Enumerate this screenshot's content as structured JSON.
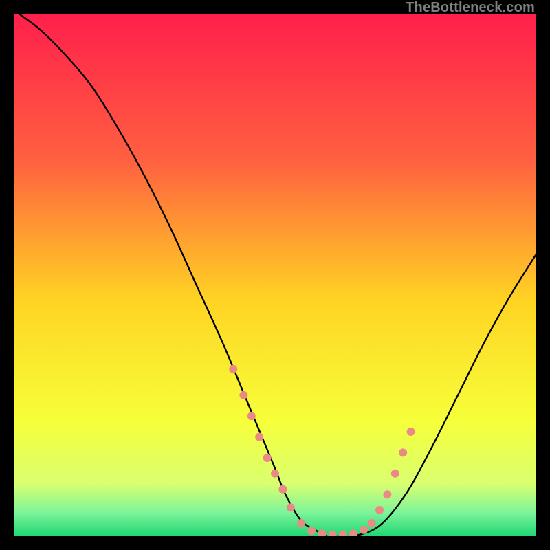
{
  "watermark": "TheBottleneck.com",
  "chart_data": {
    "type": "line",
    "title": "",
    "xlabel": "",
    "ylabel": "",
    "xlim": [
      0,
      100
    ],
    "ylim": [
      0,
      100
    ],
    "grid": false,
    "legend": false,
    "gradient_stops": [
      {
        "offset": 0.0,
        "color": "#ff1f4b"
      },
      {
        "offset": 0.28,
        "color": "#ff6040"
      },
      {
        "offset": 0.55,
        "color": "#ffd423"
      },
      {
        "offset": 0.78,
        "color": "#f6ff3a"
      },
      {
        "offset": 0.9,
        "color": "#d9ff70"
      },
      {
        "offset": 0.955,
        "color": "#7cf49a"
      },
      {
        "offset": 1.0,
        "color": "#1fd673"
      }
    ],
    "series": [
      {
        "name": "bottleneck-curve",
        "color": "#000000",
        "x": [
          1,
          5,
          10,
          15,
          20,
          25,
          30,
          35,
          40,
          45,
          50,
          52,
          55,
          58,
          60,
          62,
          65,
          70,
          75,
          80,
          85,
          90,
          95,
          100
        ],
        "y": [
          100,
          97,
          92,
          86,
          78,
          69,
          59,
          48,
          37,
          25,
          13,
          8,
          3,
          1,
          0,
          0,
          0,
          2,
          8,
          17,
          27,
          37,
          46,
          54
        ]
      }
    ],
    "markers": {
      "name": "highlight-dots",
      "color": "#e98a85",
      "radius_px": 6,
      "points": [
        {
          "x": 42,
          "y": 32
        },
        {
          "x": 44,
          "y": 27
        },
        {
          "x": 45.5,
          "y": 23
        },
        {
          "x": 47,
          "y": 19
        },
        {
          "x": 48.5,
          "y": 15
        },
        {
          "x": 50,
          "y": 12
        },
        {
          "x": 51.5,
          "y": 9
        },
        {
          "x": 53,
          "y": 5.5
        },
        {
          "x": 55,
          "y": 2.5
        },
        {
          "x": 57,
          "y": 1
        },
        {
          "x": 59,
          "y": 0.5
        },
        {
          "x": 61,
          "y": 0.3
        },
        {
          "x": 63,
          "y": 0.3
        },
        {
          "x": 65,
          "y": 0.5
        },
        {
          "x": 67,
          "y": 1.2
        },
        {
          "x": 68.5,
          "y": 2.5
        },
        {
          "x": 70,
          "y": 5
        },
        {
          "x": 71.5,
          "y": 8
        },
        {
          "x": 73,
          "y": 12
        },
        {
          "x": 74.5,
          "y": 16
        },
        {
          "x": 76,
          "y": 20
        }
      ]
    }
  }
}
